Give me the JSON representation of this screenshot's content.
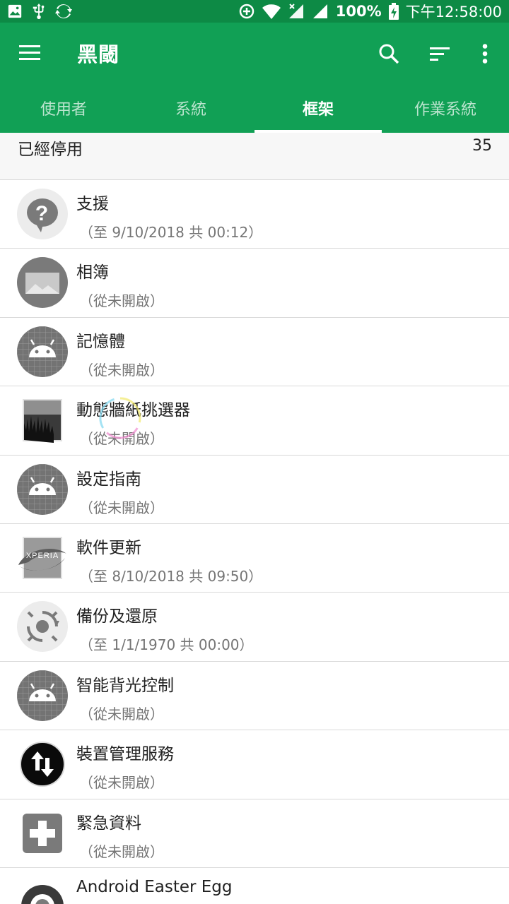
{
  "status_bar": {
    "battery": "100%",
    "time": "下午12:58:00",
    "icons": [
      "image-icon",
      "usb-icon",
      "sync-icon",
      "data-saver-icon",
      "wifi-icon",
      "no-sim-signal-icon",
      "signal-icon",
      "battery-charging-icon"
    ]
  },
  "app_bar": {
    "title": "黑閾",
    "icons": [
      "menu-icon",
      "search-icon",
      "sort-icon",
      "more-vert-icon"
    ]
  },
  "tabs": [
    {
      "label": "使用者"
    },
    {
      "label": "系統"
    },
    {
      "label": "框架",
      "active": true
    },
    {
      "label": "作業系統"
    }
  ],
  "section": {
    "title": "已經停用",
    "count": "35"
  },
  "apps": [
    {
      "title": "支援",
      "subtitle": "（至 9/10/2018 共 00:12）",
      "icon": "help-icon"
    },
    {
      "title": "相簿",
      "subtitle": "（從未開啟）",
      "icon": "gallery-icon"
    },
    {
      "title": "記憶體",
      "subtitle": "（從未開啟）",
      "icon": "android-icon"
    },
    {
      "title": "動態牆紙挑選器",
      "subtitle": "（從未開啟）",
      "icon": "live-wallpaper-icon"
    },
    {
      "title": "設定指南",
      "subtitle": "（從未開啟）",
      "icon": "android-icon"
    },
    {
      "title": "軟件更新",
      "subtitle": "（至 8/10/2018 共 09:50）",
      "icon": "xperia-update-icon",
      "icon_text": "XPERIA"
    },
    {
      "title": "備份及還原",
      "subtitle": "（至 1/1/1970 共 00:00）",
      "icon": "backup-restore-icon"
    },
    {
      "title": "智能背光控制",
      "subtitle": "（從未開啟）",
      "icon": "android-icon"
    },
    {
      "title": "裝置管理服務",
      "subtitle": "（從未開啟）",
      "icon": "device-management-icon"
    },
    {
      "title": "緊急資料",
      "subtitle": "（從未開啟）",
      "icon": "emergency-info-icon"
    },
    {
      "title": "Android Easter Egg",
      "subtitle": "",
      "icon": "easter-egg-icon"
    }
  ],
  "colors": {
    "status_bar": "#0d8a45",
    "app_bar": "#11a055",
    "tab_indicator": "#ffffff",
    "icon_gray": "#7a7a7a",
    "divider": "#d9d9d9"
  }
}
